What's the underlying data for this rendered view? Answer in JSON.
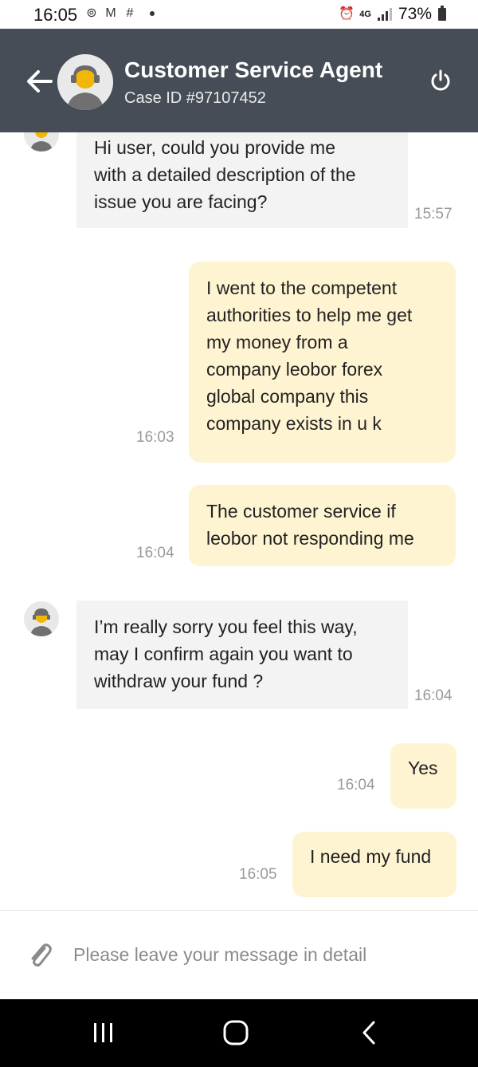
{
  "status_bar": {
    "time": "16:05",
    "network": "4G",
    "battery": "73%"
  },
  "header": {
    "title": "Customer Service Agent",
    "case_id": "Case ID #97107452",
    "back_icon": "back-arrow-icon",
    "power_icon": "power-icon"
  },
  "messages": [
    {
      "sender": "agent",
      "lines": [
        "Hi user, could you provide me",
        "with a detailed description of the",
        "issue you are facing?"
      ],
      "time": "15:57"
    },
    {
      "sender": "user",
      "lines": [
        "I went to the competent",
        "authorities to help me get",
        "my money from a",
        "company leobor forex",
        "global company this",
        "company exists in u k"
      ],
      "time": "16:03"
    },
    {
      "sender": "user",
      "lines": [
        "The customer service if",
        "leobor not responding me"
      ],
      "time": "16:04"
    },
    {
      "sender": "agent",
      "lines": [
        "I’m really sorry you feel this way,",
        "may I confirm again you want to",
        "withdraw your fund ?"
      ],
      "time": "16:04"
    },
    {
      "sender": "user",
      "lines": [
        "Yes"
      ],
      "time": "16:04"
    },
    {
      "sender": "user",
      "lines": [
        "I need my fund"
      ],
      "time": "16:05"
    }
  ],
  "input": {
    "placeholder": "Please leave your message in detail",
    "attach_icon": "paperclip-icon"
  },
  "nav": {
    "recents_icon": "recents-icon",
    "home_icon": "home-icon",
    "back_icon": "back-icon"
  },
  "colors": {
    "header_bg": "#474d56",
    "agent_bubble": "#f3f3f3",
    "user_bubble": "#fff4d1"
  }
}
